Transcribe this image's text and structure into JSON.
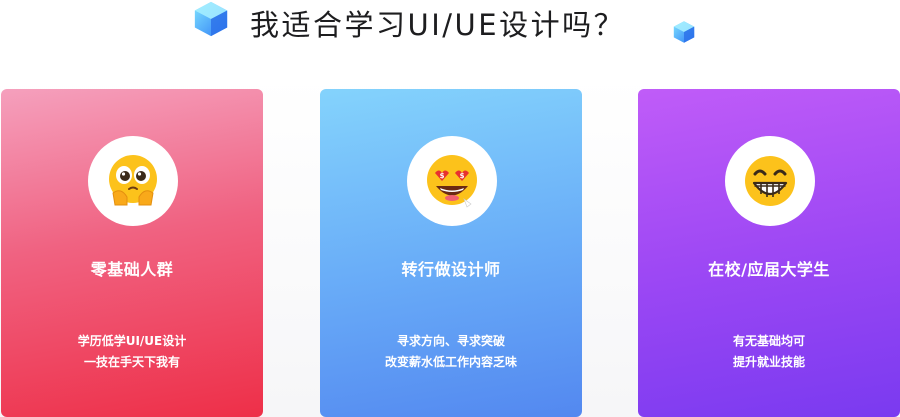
{
  "header": {
    "title": "我适合学习UI/UE设计吗？",
    "decor_icons": [
      "cube-icon",
      "cube-icon"
    ]
  },
  "cards": [
    {
      "icon": "shy-emoji-icon",
      "title": "零基础人群",
      "desc_line1": "学历低学UI/UE设计",
      "desc_line2": "一技在手天下我有",
      "gradient": [
        "#f5a0bd",
        "#ee2f48"
      ]
    },
    {
      "icon": "money-eyes-emoji-icon",
      "title": "转行做设计师",
      "desc_line1": "寻求方向、寻求突破",
      "desc_line2": "改变薪水低工作内容乏味",
      "gradient": [
        "#84d3fc",
        "#5388f0"
      ]
    },
    {
      "icon": "grinning-emoji-icon",
      "title": "在校/应届大学生",
      "desc_line1": "有无基础均可",
      "desc_line2": "提升就业技能",
      "gradient": [
        "#c05cf8",
        "#7a3af0"
      ]
    }
  ]
}
